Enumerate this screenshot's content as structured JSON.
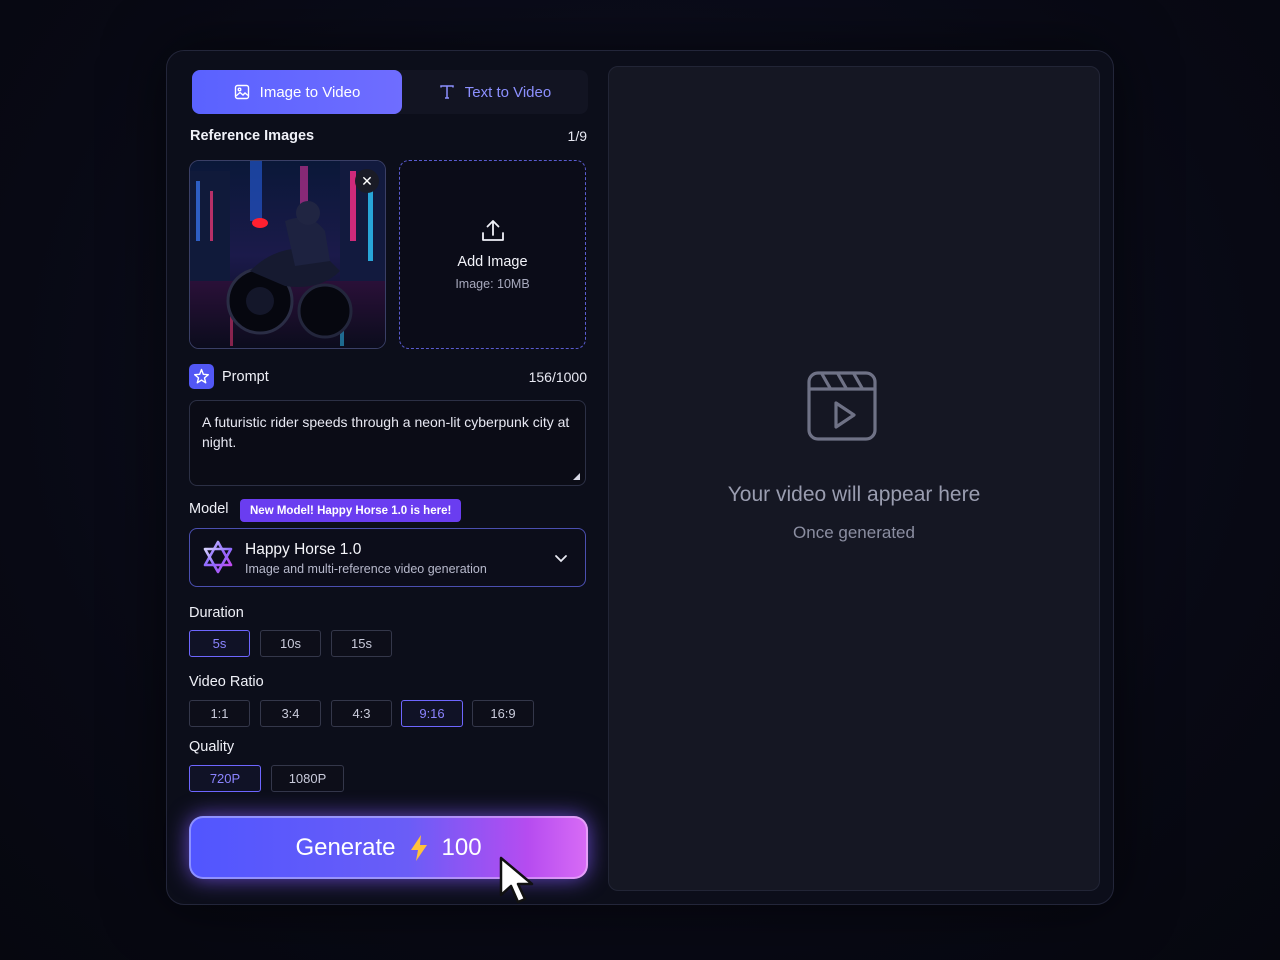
{
  "tabs": [
    {
      "label": "Image to Video",
      "icon": "image-icon",
      "active": true
    },
    {
      "label": "Text to Video",
      "icon": "text-icon",
      "active": false
    }
  ],
  "reference": {
    "label": "Reference Images",
    "count": "1/9",
    "upload_title": "Add Image",
    "upload_hint": "Image: 10MB"
  },
  "prompt": {
    "label": "Prompt",
    "count": "156/1000",
    "value": "A futuristic rider speeds through a neon-lit cyberpunk city at night."
  },
  "model": {
    "label": "Model",
    "badge": "New Model! Happy Horse 1.0 is here!",
    "name": "Happy Horse 1.0",
    "description": "Image and multi-reference video generation"
  },
  "duration": {
    "label": "Duration",
    "options": [
      "5s",
      "10s",
      "15s"
    ],
    "selected": "5s"
  },
  "ratio": {
    "label": "Video Ratio",
    "options": [
      "1:1",
      "3:4",
      "4:3",
      "9:16",
      "16:9"
    ],
    "selected": "9:16"
  },
  "quality": {
    "label": "Quality",
    "options": [
      "720P",
      "1080P"
    ],
    "selected": "720P"
  },
  "generate": {
    "label": "Generate",
    "credits": "100",
    "icon": "lightning-icon"
  },
  "preview": {
    "title": "Your video will appear here",
    "subtitle": "Once generated",
    "icon": "video-clapper-icon"
  },
  "colors": {
    "accent": "#5a62ff",
    "badge": "#6a3df0",
    "selected_option": "#6e66ff"
  }
}
